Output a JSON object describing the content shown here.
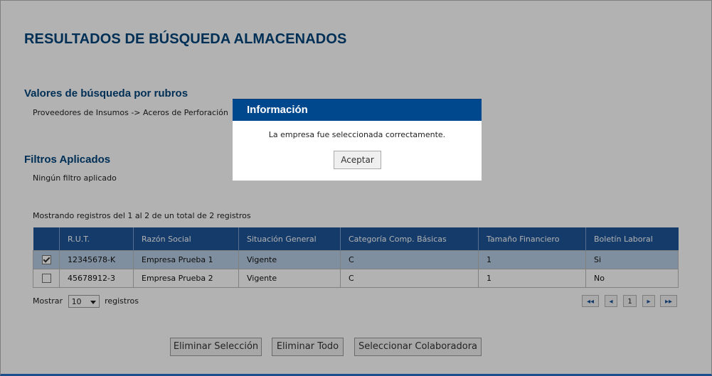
{
  "page": {
    "title": "RESULTADOS DE BÚSQUEDA ALMACENADOS",
    "rubros_heading": "Valores de búsqueda por rubros",
    "rubros_value": "Proveedores de Insumos -> Aceros de Perforación",
    "filtros_heading": "Filtros Aplicados",
    "filtros_value": "Ningún filtro aplicado",
    "records_info": "Mostrando registros del 1 al 2 de un total de 2 registros"
  },
  "table": {
    "headers": [
      "R.U.T.",
      "Razón Social",
      "Situación General",
      "Categoría Comp. Básicas",
      "Tamaño Financiero",
      "Boletín Laboral"
    ],
    "rows": [
      {
        "checked": true,
        "cells": [
          "12345678-K",
          "Empresa Prueba 1",
          "Vigente",
          "C",
          "1",
          "Si"
        ]
      },
      {
        "checked": false,
        "cells": [
          "45678912-3",
          "Empresa Prueba 2",
          "Vigente",
          "C",
          "1",
          "No"
        ]
      }
    ]
  },
  "paging": {
    "show_label": "Mostrar",
    "page_size": "10",
    "records_label": "registros",
    "first": "◂◂",
    "prev": "◂",
    "current_page": "1",
    "next": "▸",
    "last": "▸▸"
  },
  "actions": {
    "delete_selection": "Eliminar Selección",
    "delete_all": "Eliminar Todo",
    "select_collaborator": "Seleccionar Colaboradora"
  },
  "dialog": {
    "title": "Información",
    "message": "La empresa fue seleccionada correctamente.",
    "ok_label": "Aceptar"
  },
  "colors": {
    "header_blue": "#1e5599",
    "title_blue": "#00447c",
    "dialog_header": "#00488d",
    "selected_row": "#b8cde4"
  }
}
